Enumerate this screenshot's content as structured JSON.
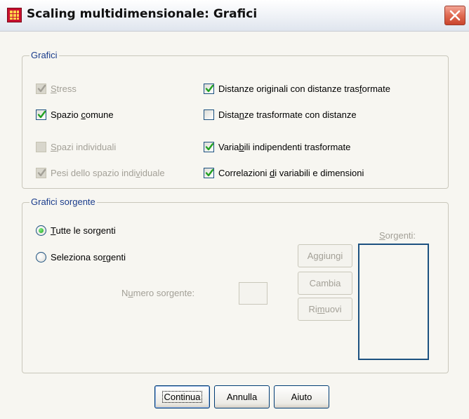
{
  "window": {
    "title": "Scaling multidimensionale: Grafici"
  },
  "plots_group": {
    "legend": "Grafici",
    "left": [
      {
        "pre": "",
        "acc": "S",
        "post": "tress",
        "checked": true,
        "enabled": false
      },
      {
        "pre": "Spazio ",
        "acc": "c",
        "post": "omune",
        "checked": true,
        "enabled": true
      },
      {
        "pre": "",
        "acc": "S",
        "post": "pazi individuali",
        "checked": false,
        "enabled": false
      },
      {
        "pre": "Pesi dello spazio indi",
        "acc": "v",
        "post": "iduale",
        "checked": true,
        "enabled": false
      }
    ],
    "right": [
      {
        "pre": "Distanze originali con distanze tras",
        "acc": "f",
        "post": "ormate",
        "checked": true,
        "enabled": true
      },
      {
        "pre": "Dista",
        "acc": "n",
        "post": "ze trasformate con distanze",
        "checked": false,
        "enabled": true
      },
      {
        "pre": "Varia",
        "acc": "b",
        "post": "ili indipendenti trasformate",
        "checked": true,
        "enabled": true
      },
      {
        "pre": "Correlazioni ",
        "acc": "d",
        "post": "i variabili e dimensioni",
        "checked": true,
        "enabled": true
      }
    ]
  },
  "source_group": {
    "legend": "Grafici sorgente",
    "all_sources": {
      "pre": "",
      "acc": "T",
      "post": "utte le sorgenti",
      "selected": true
    },
    "select_sources": {
      "pre": "Seleziona so",
      "acc": "r",
      "post": "genti",
      "selected": false
    },
    "source_number": {
      "pre": "N",
      "acc": "u",
      "post": "mero sorgente:",
      "value": ""
    },
    "sources_list": {
      "pre": "",
      "acc": "S",
      "post": "orgenti:"
    },
    "add": "Aggiungi",
    "change": "Cambia",
    "remove": {
      "pre": "Ri",
      "acc": "m",
      "post": "uovi"
    }
  },
  "footer": {
    "continue": "Continua",
    "cancel": "Annulla",
    "help": "Aiuto"
  },
  "colors": {
    "group_label": "#1a3c8c",
    "disabled_text": "#a3a097",
    "list_border": "#1c5180"
  }
}
